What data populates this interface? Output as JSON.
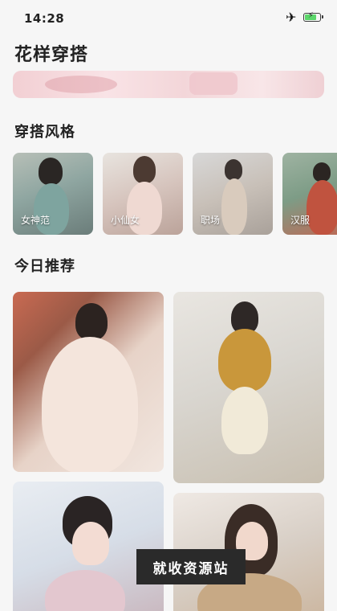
{
  "status_bar": {
    "time": "14:28",
    "airplane_icon": "airplane-icon",
    "battery_icon": "battery-charging-icon"
  },
  "header": {
    "title": "花样穿搭"
  },
  "sections": {
    "styles": {
      "title": "穿搭风格",
      "items": [
        {
          "label": "女神范"
        },
        {
          "label": "小仙女"
        },
        {
          "label": "职场"
        },
        {
          "label": "汉服"
        }
      ]
    },
    "recommend": {
      "title": "今日推荐"
    }
  },
  "overlay": {
    "watermark": "就收资源站"
  },
  "colors": {
    "background": "#f6f6f6",
    "banner_pink": "#f3d6d9",
    "text": "#222222"
  }
}
